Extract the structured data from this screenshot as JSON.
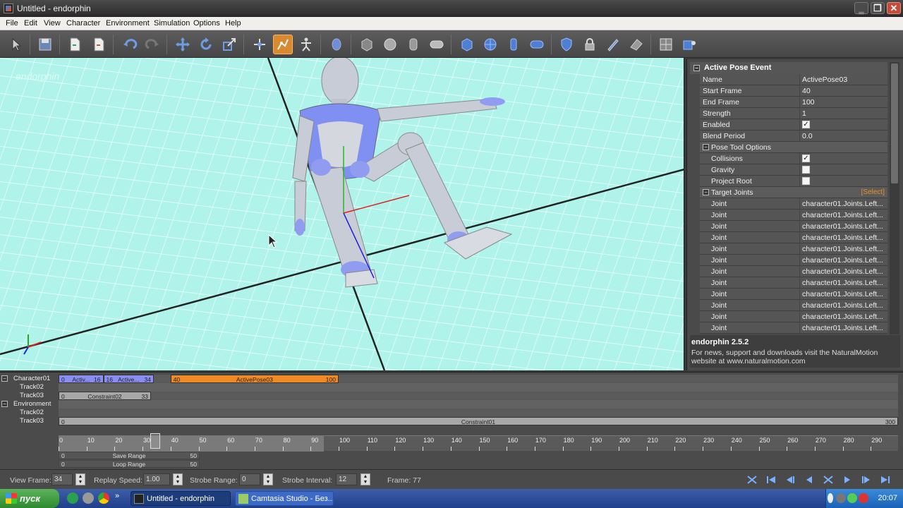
{
  "window": {
    "title": "Untitled - endorphin"
  },
  "menu": [
    "File",
    "Edit",
    "View",
    "Character",
    "Environment",
    "Simulation",
    "Options",
    "Help"
  ],
  "toolbar": {
    "tools": [
      "select-icon",
      "save-icon",
      "import-icon",
      "export-icon",
      "undo-icon",
      "redo-icon",
      "move-icon",
      "rotate-icon",
      "scale-icon",
      "joint-move-icon",
      "active-pose-icon",
      "character-icon",
      "body-part-icon",
      "box-icon",
      "sphere-icon",
      "cylinder-icon",
      "capsule-icon",
      "cube-object-icon",
      "globe-icon",
      "cylinder-object-icon",
      "capsule-object-icon",
      "shield-icon",
      "lock-icon",
      "pen-icon",
      "eraser-icon",
      "layout-icon",
      "puzzle-icon"
    ],
    "active": "active-pose-icon"
  },
  "viewport": {
    "watermark": "endorphin"
  },
  "properties": {
    "header": "Active Pose Event",
    "rows": [
      {
        "name": "Name",
        "value": "ActivePose03"
      },
      {
        "name": "Start Frame",
        "value": "40"
      },
      {
        "name": "End Frame",
        "value": "100"
      },
      {
        "name": "Strength",
        "value": "1"
      },
      {
        "name": "Enabled",
        "checked": true
      },
      {
        "name": "Blend Period",
        "value": "0.0"
      }
    ],
    "pose_tool_options": {
      "label": "Pose Tool Options",
      "rows": [
        {
          "name": "Collisions",
          "checked": true
        },
        {
          "name": "Gravity",
          "checked": false
        },
        {
          "name": "Project Root",
          "checked": false
        }
      ]
    },
    "target_joints": {
      "label": "Target Joints",
      "select_label": "[Select]",
      "joint_label": "Joint",
      "joint_value": "character01.Joints.Left...",
      "count": 12
    },
    "info": {
      "title": "endorphin 2.5.2",
      "text": "For news, support and downloads visit the NaturalMotion website at www.naturalmotion.com"
    }
  },
  "timeline": {
    "tracks": [
      {
        "label": "Character01",
        "type": "group"
      },
      {
        "label": "Track02",
        "type": "track"
      },
      {
        "label": "Track03",
        "type": "track"
      },
      {
        "label": "Environment",
        "type": "group"
      },
      {
        "label": "Track02",
        "type": "track"
      },
      {
        "label": "Track03",
        "type": "track"
      }
    ],
    "clips": [
      {
        "track": 0,
        "start": "0",
        "name": "Activ...",
        "end": "16",
        "color": "#8a8ef0"
      },
      {
        "track": 0,
        "start": "16",
        "name": "Active...",
        "end": "34",
        "color": "#8a8ef0"
      },
      {
        "track": 0,
        "start": "40",
        "name": "ActivePose03",
        "end": "100",
        "color": "#f08a24"
      },
      {
        "track": 2,
        "start": "0",
        "name": "Constraint02",
        "end": "33",
        "color": "#a8a8a8"
      },
      {
        "track": 5,
        "start": "0",
        "name": "Constraint01",
        "end": "300",
        "color": "#a8a8a8"
      }
    ],
    "ruler": [
      0,
      10,
      20,
      30,
      40,
      50,
      60,
      70,
      80,
      90,
      100,
      110,
      120,
      130,
      140,
      150,
      160,
      170,
      180,
      190,
      200,
      210,
      220,
      230,
      240,
      250,
      260,
      270,
      280,
      290
    ],
    "save_range": {
      "label": "Save Range",
      "start": "0",
      "end": "50"
    },
    "loop_range": {
      "label": "Loop Range",
      "start": "0",
      "end": "50"
    }
  },
  "bottom": {
    "view_frame_label": "View Frame:",
    "view_frame": "34",
    "replay_speed_label": "Replay Speed:",
    "replay_speed": "1.00",
    "strobe_range_label": "Strobe Range:",
    "strobe_range": "0",
    "strobe_interval_label": "Strobe Interval:",
    "strobe_interval": "12",
    "frame_label": "Frame: 77"
  },
  "taskbar": {
    "start": "пуск",
    "tasks": [
      "Untitled - endorphin",
      "Camtasia Studio - Без..."
    ],
    "clock": "20:07"
  }
}
